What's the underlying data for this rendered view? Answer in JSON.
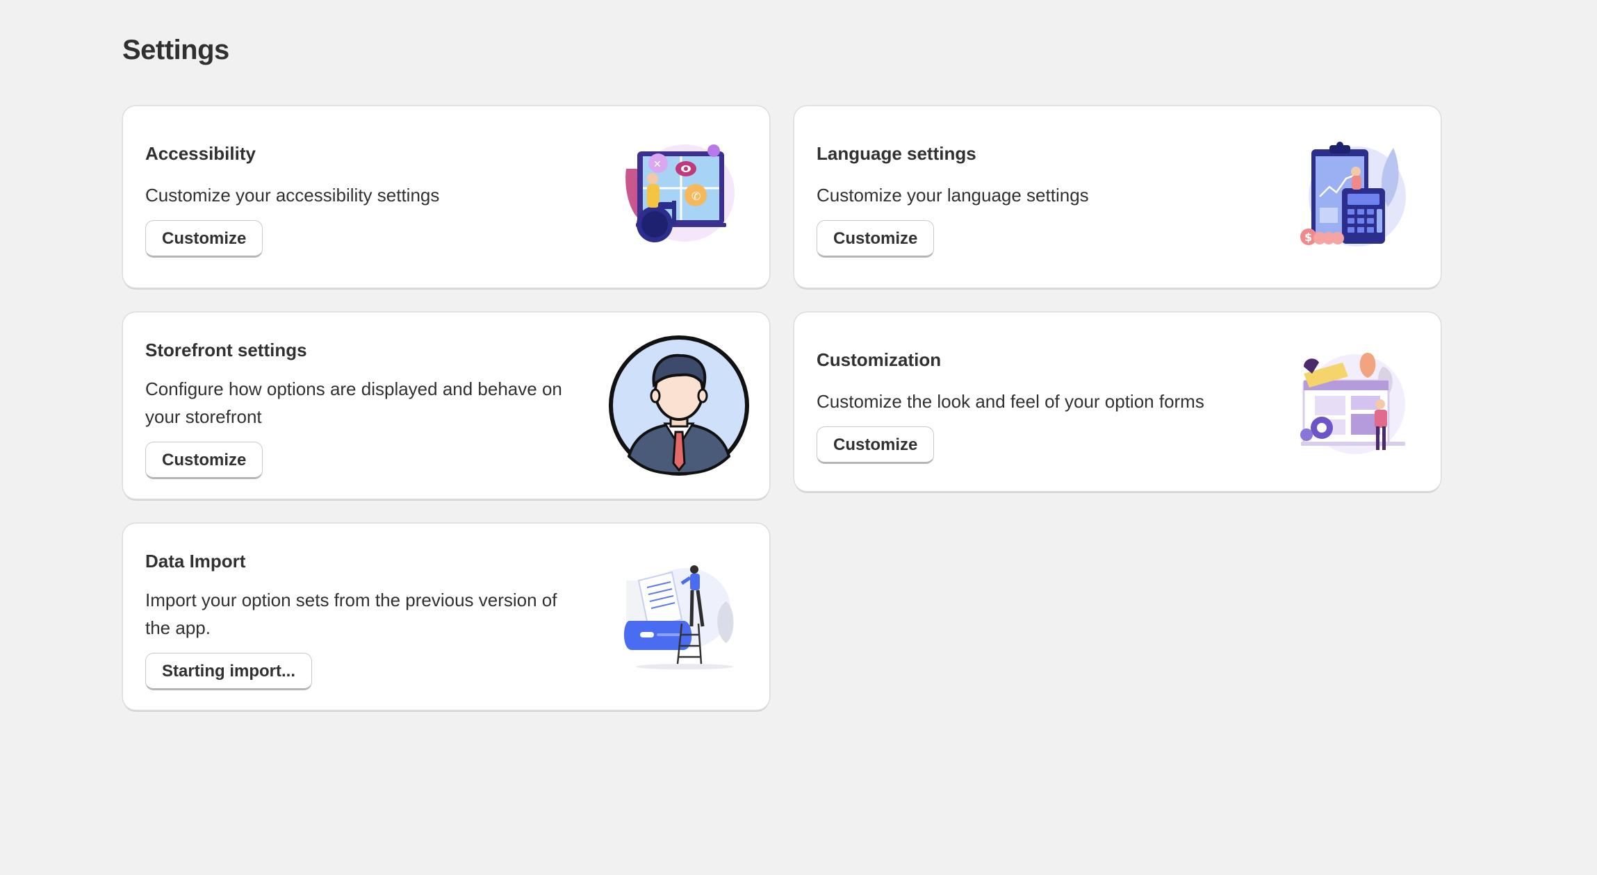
{
  "page": {
    "title": "Settings"
  },
  "cards": [
    {
      "id": "accessibility",
      "title": "Accessibility",
      "description": "Customize your accessibility settings",
      "button_label": "Customize",
      "illustration": "accessibility-illustration"
    },
    {
      "id": "language",
      "title": "Language settings",
      "description": "Customize your language settings",
      "button_label": "Customize",
      "illustration": "language-illustration"
    },
    {
      "id": "storefront",
      "title": "Storefront settings",
      "description": "Configure how options are displayed and behave on your storefront",
      "button_label": "Customize",
      "illustration": "storefront-avatar-illustration"
    },
    {
      "id": "customization",
      "title": "Customization",
      "description": "Customize the look and feel of your option forms",
      "button_label": "Customize",
      "illustration": "customization-illustration"
    },
    {
      "id": "data-import",
      "title": "Data Import",
      "description": "Import your option sets from the previous version of the app.",
      "button_label": "Starting import...",
      "illustration": "data-import-illustration"
    }
  ],
  "colors": {
    "background": "#f1f1f1",
    "card": "#ffffff",
    "text": "#303030",
    "accent_blue": "#2b2e8c",
    "accent_purple": "#8b5cf6",
    "accent_pink": "#f08a8a"
  }
}
